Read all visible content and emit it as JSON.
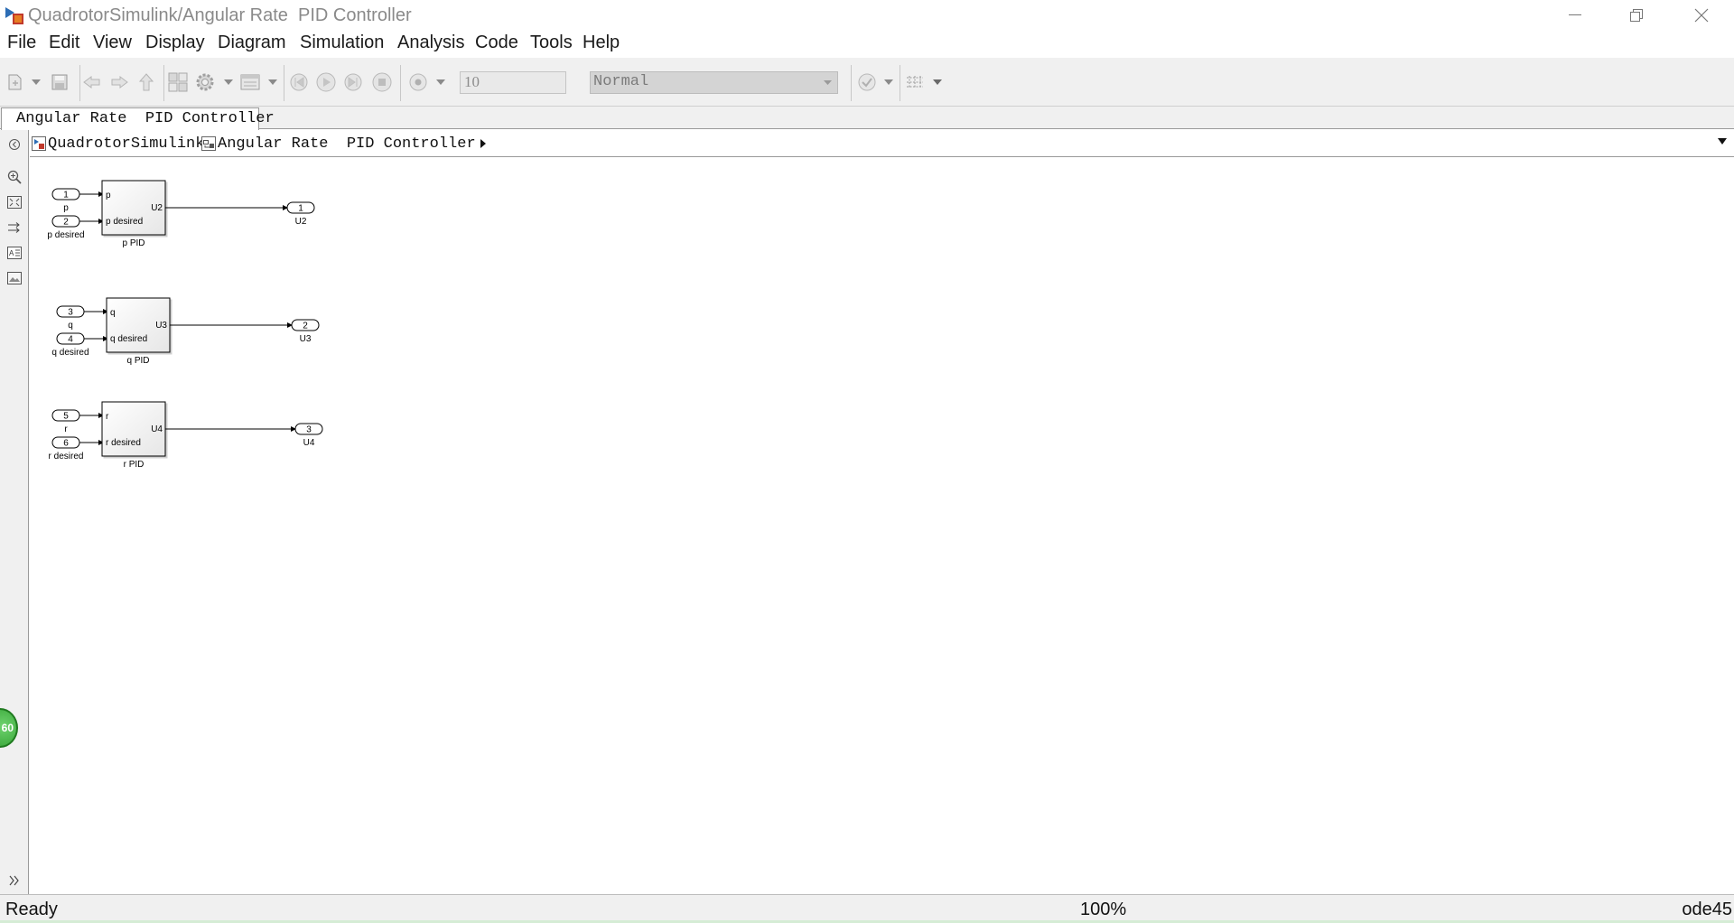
{
  "window": {
    "title": "QuadrotorSimulink/Angular Rate  PID Controller"
  },
  "menu": {
    "items": [
      "File",
      "Edit",
      "View",
      "Display",
      "Diagram",
      "Simulation",
      "Analysis",
      "Code",
      "Tools",
      "Help"
    ]
  },
  "toolbar": {
    "stop_time": "10",
    "sim_mode": "Normal",
    "icons": [
      "new-model-icon",
      "save-icon",
      "back-icon",
      "forward-icon",
      "up-icon",
      "library-browser-icon",
      "model-config-icon",
      "model-explorer-icon",
      "step-back-icon",
      "run-icon",
      "step-forward-icon",
      "stop-icon",
      "record-icon",
      "model-advisor-icon",
      "build-icon"
    ]
  },
  "tab": {
    "label": "Angular Rate  PID Controller"
  },
  "breadcrumb": {
    "items": [
      "QuadrotorSimulink",
      "Angular Rate  PID Controller"
    ]
  },
  "diagram": {
    "blocks": [
      {
        "name": "p PID",
        "inputs": [
          {
            "label": "p",
            "port": "1",
            "port_name": "p"
          },
          {
            "label": "p desired",
            "port": "2",
            "port_name": "p desired"
          }
        ],
        "output_label": "U2",
        "outport": {
          "port": "1",
          "name": "U2"
        }
      },
      {
        "name": "q PID",
        "inputs": [
          {
            "label": "q",
            "port": "3",
            "port_name": "q"
          },
          {
            "label": "q desired",
            "port": "4",
            "port_name": "q desired"
          }
        ],
        "output_label": "U3",
        "outport": {
          "port": "2",
          "name": "U3"
        }
      },
      {
        "name": "r PID",
        "inputs": [
          {
            "label": "r",
            "port": "5",
            "port_name": "r"
          },
          {
            "label": "r desired",
            "port": "6",
            "port_name": "r desired"
          }
        ],
        "output_label": "U4",
        "outport": {
          "port": "3",
          "name": "U4"
        }
      }
    ]
  },
  "badge": {
    "text": "60"
  },
  "status": {
    "text": "Ready",
    "zoom": "100%",
    "solver": "ode45"
  },
  "colors": {
    "toolbar_bg": "#f0f0f0",
    "canvas_bg": "#ffffff",
    "badge_green": "#3aaa3a"
  }
}
